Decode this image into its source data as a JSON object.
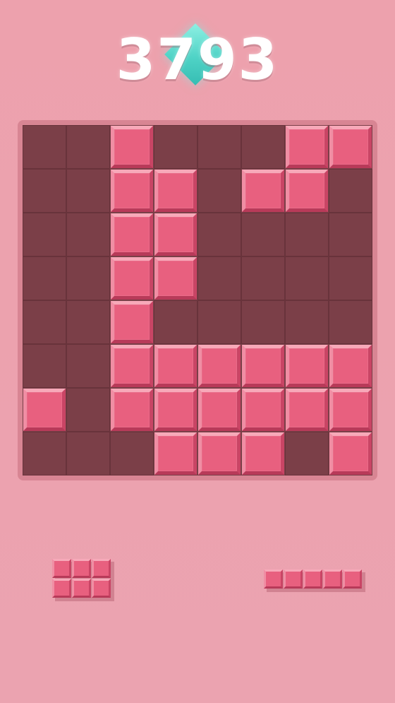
{
  "game": {
    "score": "3793",
    "colors": {
      "background": "#eda1ad",
      "board": "#7b3f48",
      "block": "#e8607f",
      "score_gem": "#4fd3c6"
    },
    "board": {
      "rows": 8,
      "cols": 8,
      "cells": [
        [
          0,
          0,
          1,
          0,
          0,
          0,
          1,
          1
        ],
        [
          0,
          0,
          1,
          1,
          0,
          1,
          1,
          0
        ],
        [
          0,
          0,
          1,
          1,
          0,
          0,
          0,
          0
        ],
        [
          0,
          0,
          1,
          1,
          0,
          0,
          0,
          0
        ],
        [
          0,
          0,
          1,
          0,
          0,
          0,
          0,
          0
        ],
        [
          0,
          0,
          1,
          1,
          1,
          1,
          1,
          1
        ],
        [
          1,
          0,
          1,
          1,
          1,
          1,
          1,
          1
        ],
        [
          0,
          0,
          0,
          1,
          1,
          1,
          0,
          1
        ]
      ]
    },
    "pieces": [
      {
        "name": "square-2x3",
        "shape": [
          [
            1,
            1,
            1
          ],
          [
            1,
            1,
            1
          ]
        ]
      },
      {
        "name": "line-1x5",
        "shape": [
          [
            1,
            1,
            1,
            1,
            1
          ]
        ]
      }
    ]
  }
}
